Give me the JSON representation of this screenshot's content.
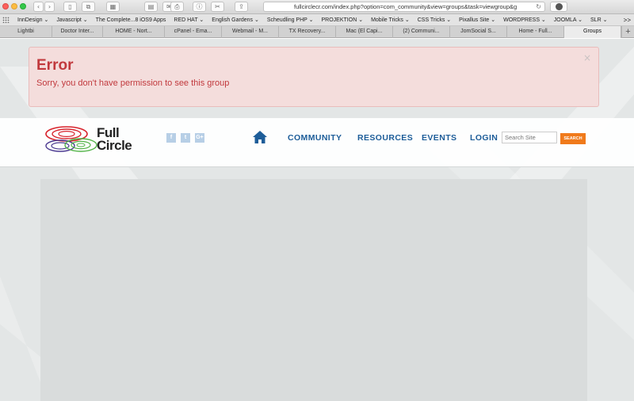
{
  "browser": {
    "url": "fullcirclecr.com/index.php?option=com_community&view=groups&task=viewgroup&g",
    "bookmarks": [
      "InnDesign ⌄",
      "Javascript ⌄",
      "The Complete...8 iOS9 Apps",
      "RED HAT ⌄",
      "English Gardens ⌄",
      "Scheudling PHP ⌄",
      "PROJEKTION ⌄",
      "Mobile Tricks ⌄",
      "CSS Tricks ⌄",
      "Pixallus Site ⌄",
      "WORDPRESS ⌄",
      "JOOMLA ⌄",
      "SLR ⌄"
    ],
    "bookmarks_more": ">>",
    "tabs": [
      "Lightbi",
      "Doctor Inter...",
      "HOME - Nort...",
      "cPanel - Ema...",
      "Webmail - M...",
      "TX Recovery...",
      "Mac (El Capi...",
      "(2) Communi...",
      "JomSocial S...",
      "Home - Full...",
      "Groups"
    ],
    "new_tab": "+"
  },
  "alert": {
    "title": "Error",
    "message": "Sorry, you don't have permission to see this group",
    "close": "×"
  },
  "header": {
    "logo_line1": "Full",
    "logo_line2": "Circle",
    "social": [
      "f",
      "t",
      "G+"
    ],
    "nav": [
      "COMMUNITY",
      "RESOURCES",
      "EVENTS",
      "LOGIN"
    ],
    "search_placeholder": "Search Site",
    "search_button": "SEARCH"
  },
  "colors": {
    "error": "#c1393d",
    "nav": "#1d5d99",
    "search_button": "#f07a1b"
  }
}
